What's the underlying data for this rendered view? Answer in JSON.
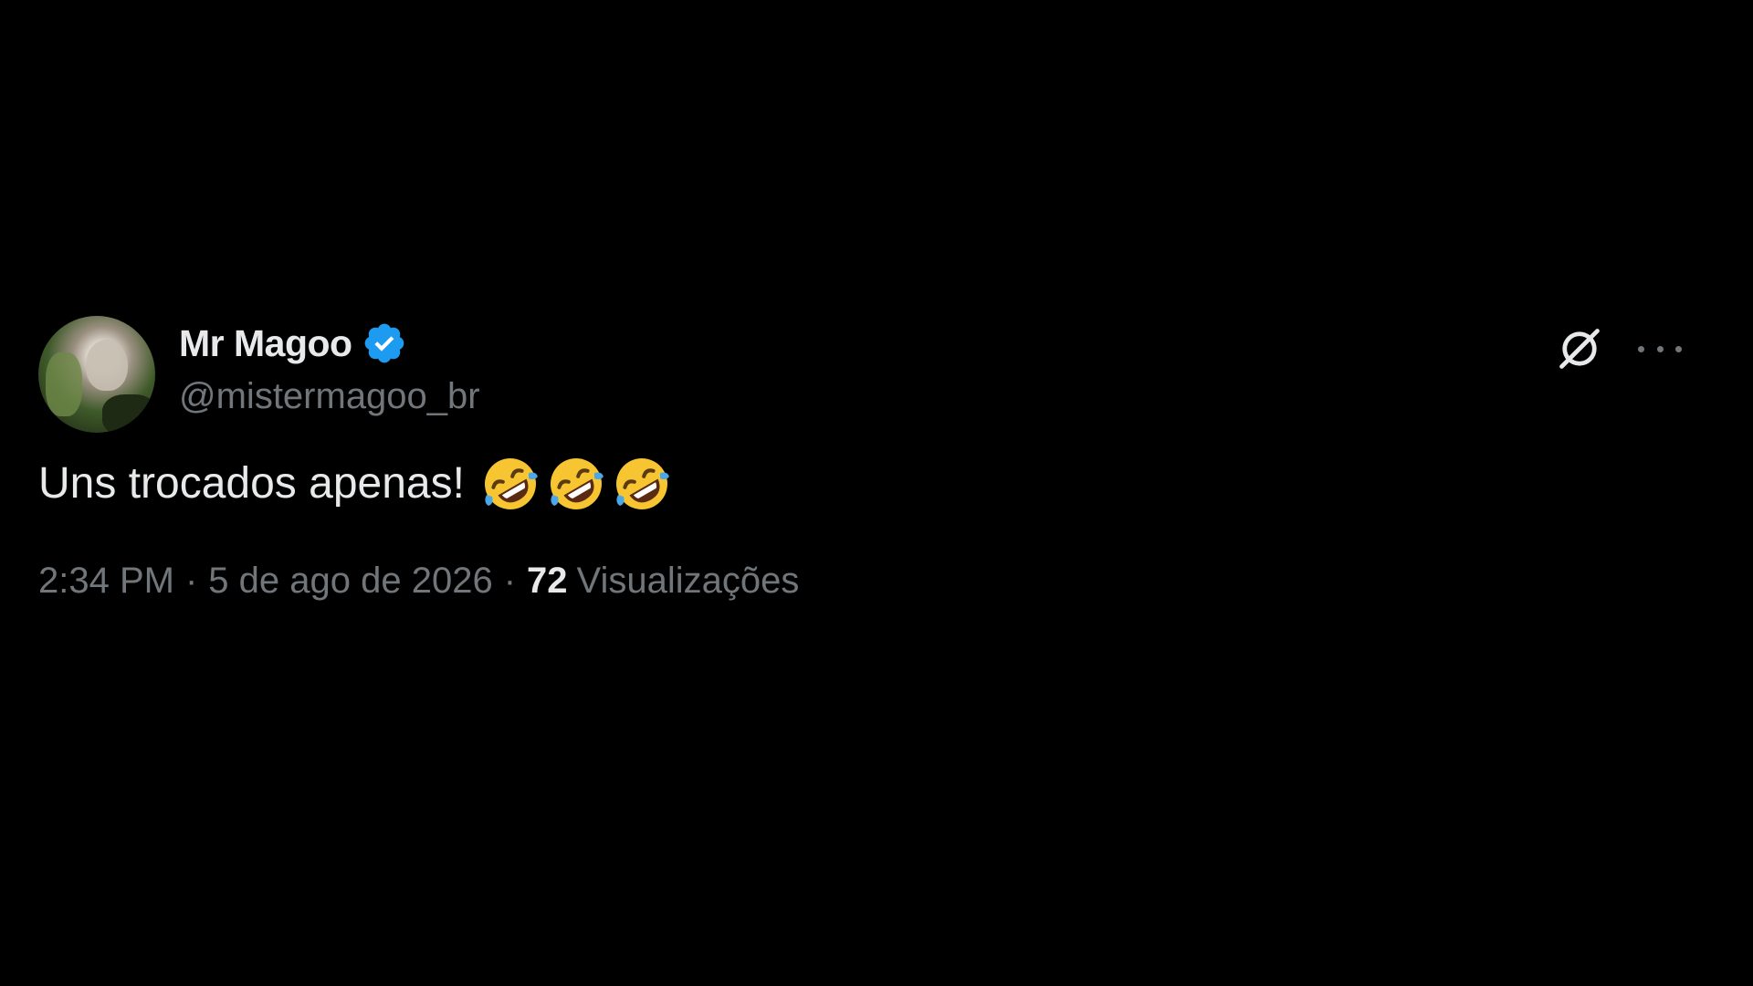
{
  "tweet": {
    "display_name": "Mr Magoo",
    "handle": "@mistermagoo_br",
    "text": "Uns trocados apenas!",
    "emojis": [
      "rolling-on-floor-laughing",
      "rolling-on-floor-laughing",
      "rolling-on-floor-laughing"
    ],
    "time": "2:34 PM",
    "date": "5 de ago de 2026",
    "separator": "·",
    "views_count": "72",
    "views_label": "Visualizações",
    "verified": true
  },
  "icons": {
    "verified": "verified-badge-icon",
    "grok": "grok-icon",
    "more": "more-options-icon"
  },
  "colors": {
    "background": "#000000",
    "primary_text": "#e7e9ea",
    "secondary_text": "#71767b",
    "verified_blue": "#1d9bf0"
  }
}
